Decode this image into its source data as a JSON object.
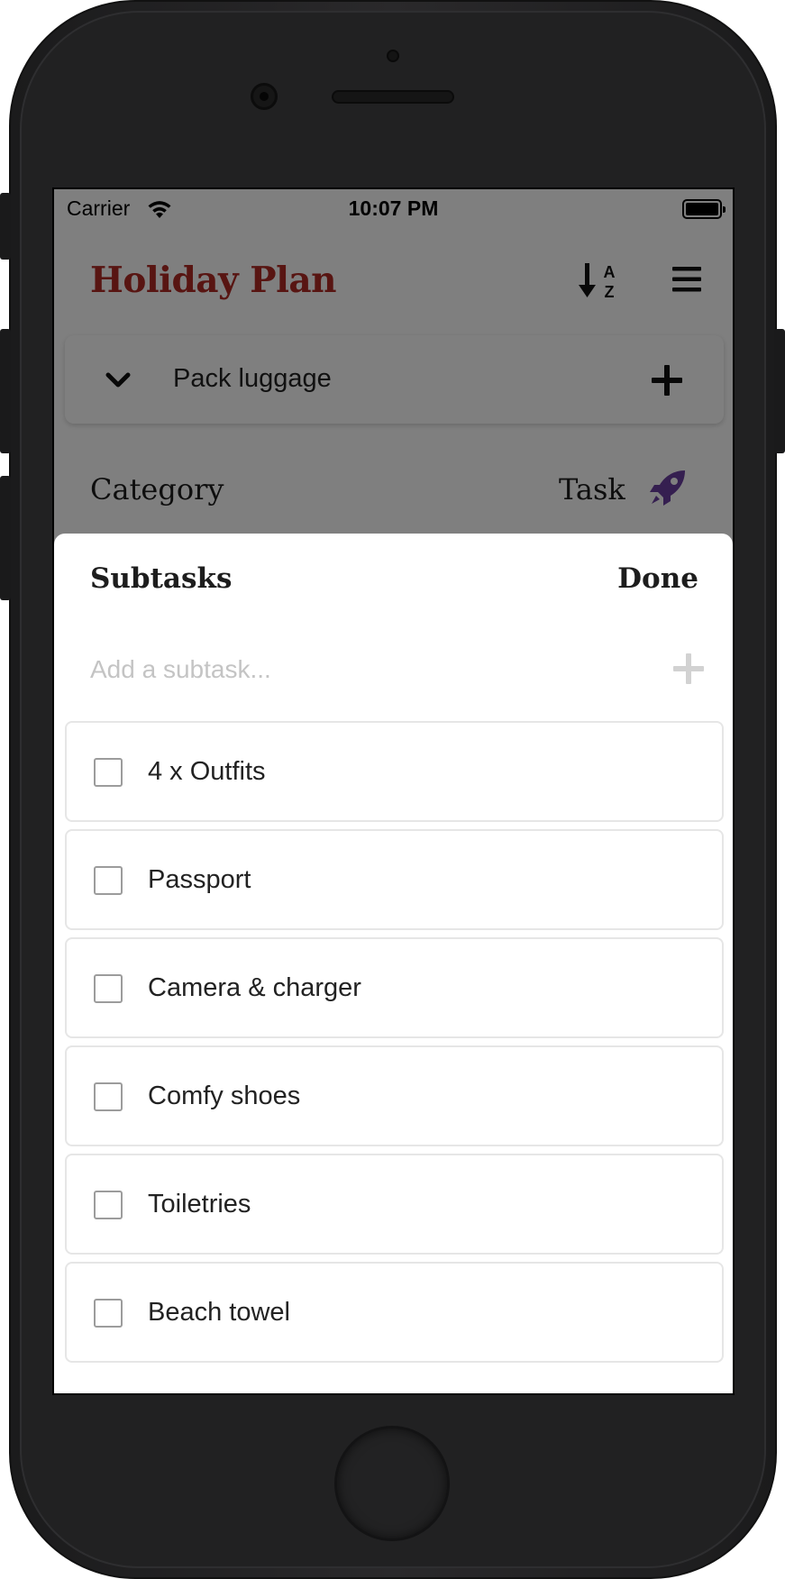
{
  "status_bar": {
    "carrier": "Carrier",
    "time": "10:07 PM"
  },
  "header": {
    "title": "Holiday Plan",
    "title_color": "#b12a25",
    "sort_icon": "sort-alpha-icon",
    "menu_icon": "hamburger-menu-icon"
  },
  "task_card": {
    "label": "Pack luggage",
    "expand_icon": "chevron-down-icon",
    "add_icon": "plus-icon"
  },
  "category_row": {
    "label": "Category",
    "value": "Task",
    "icon": "rocket-icon",
    "icon_color": "#6b3fa0"
  },
  "sheet": {
    "title": "Subtasks",
    "done_label": "Done",
    "input_placeholder": "Add a subtask...",
    "input_value": "",
    "items": [
      {
        "label": "4 x Outfits",
        "checked": false
      },
      {
        "label": "Passport",
        "checked": false
      },
      {
        "label": "Camera & charger",
        "checked": false
      },
      {
        "label": "Comfy shoes",
        "checked": false
      },
      {
        "label": "Toiletries",
        "checked": false
      },
      {
        "label": "Beach towel",
        "checked": false
      }
    ]
  }
}
